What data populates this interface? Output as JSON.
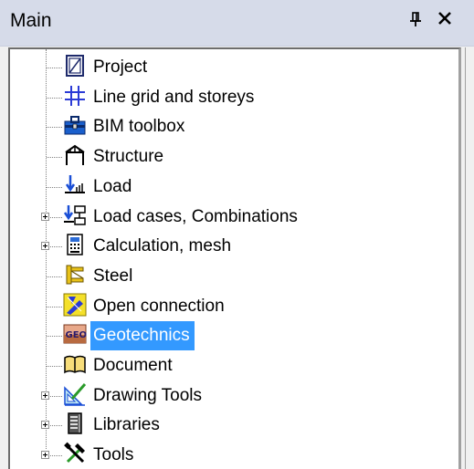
{
  "panel": {
    "title": "Main",
    "pin_glyph": "⨪",
    "close_glyph": "×"
  },
  "tree": {
    "items": [
      {
        "label": "Project",
        "icon": "project-icon",
        "expandable": false,
        "selected": false
      },
      {
        "label": "Line grid and storeys",
        "icon": "grid-icon",
        "expandable": false,
        "selected": false
      },
      {
        "label": "BIM toolbox",
        "icon": "toolbox-icon",
        "expandable": false,
        "selected": false
      },
      {
        "label": "Structure",
        "icon": "structure-icon",
        "expandable": false,
        "selected": false
      },
      {
        "label": "Load",
        "icon": "load-icon",
        "expandable": false,
        "selected": false
      },
      {
        "label": "Load cases, Combinations",
        "icon": "load-cases-icon",
        "expandable": true,
        "selected": false
      },
      {
        "label": "Calculation, mesh",
        "icon": "calculator-icon",
        "expandable": true,
        "selected": false
      },
      {
        "label": "Steel",
        "icon": "steel-icon",
        "expandable": false,
        "selected": false
      },
      {
        "label": "Open connection",
        "icon": "connection-icon",
        "expandable": false,
        "selected": false
      },
      {
        "label": "Geotechnics",
        "icon": "geotechnics-icon",
        "expandable": false,
        "selected": true
      },
      {
        "label": "Document",
        "icon": "document-icon",
        "expandable": false,
        "selected": false
      },
      {
        "label": "Drawing Tools",
        "icon": "drawing-tools-icon",
        "expandable": true,
        "selected": false
      },
      {
        "label": "Libraries",
        "icon": "libraries-icon",
        "expandable": true,
        "selected": false
      },
      {
        "label": "Tools",
        "icon": "tools-icon",
        "expandable": true,
        "selected": false
      }
    ]
  },
  "colors": {
    "header_bg": "#d6dbe9",
    "selection_bg": "#3399ff",
    "tree_bg": "#ffffff"
  }
}
